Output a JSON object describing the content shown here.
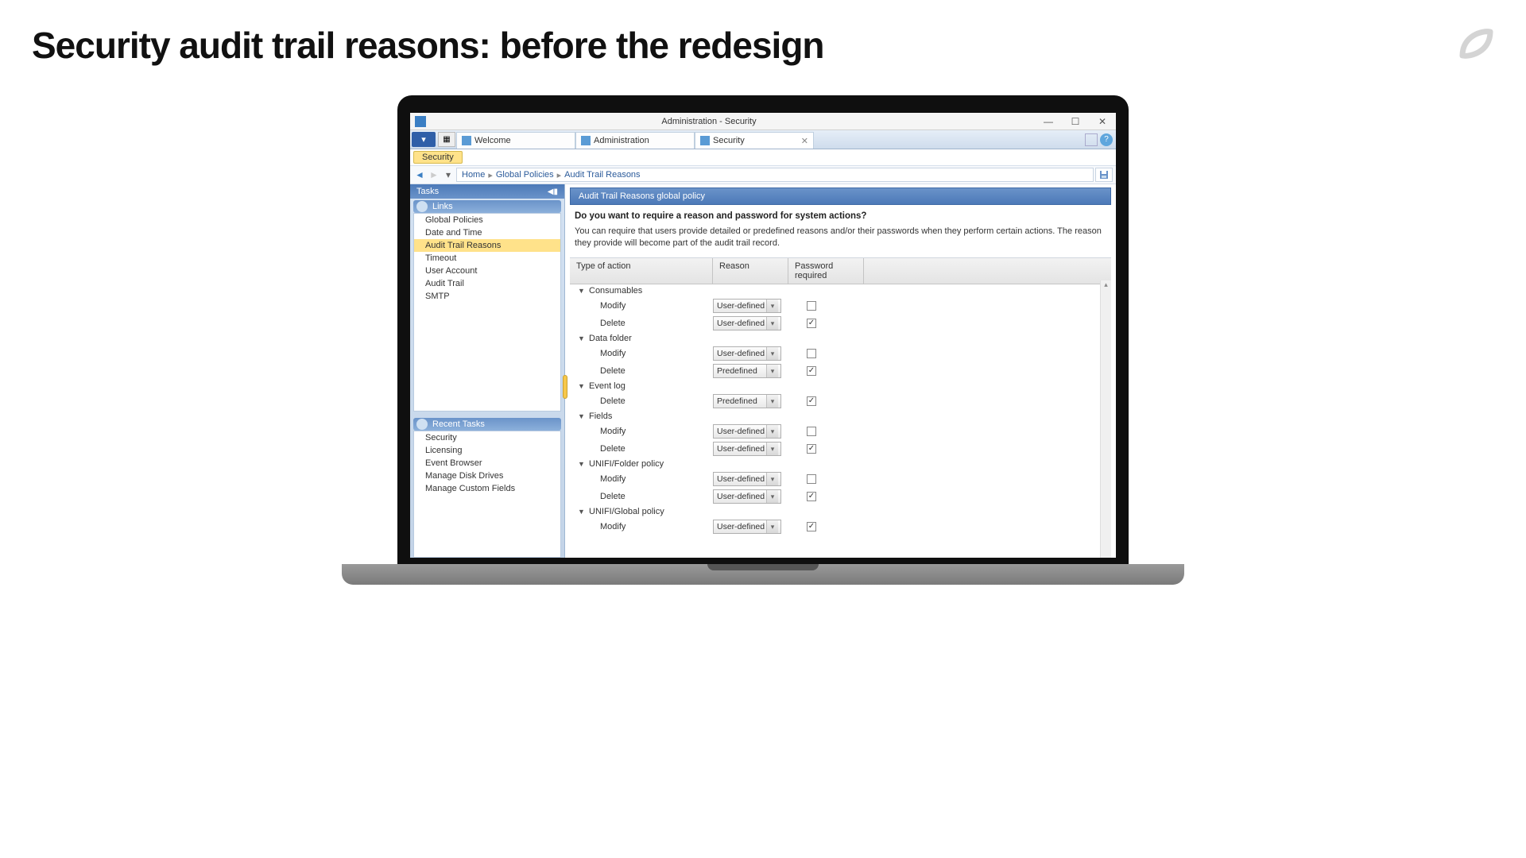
{
  "slide": {
    "title": "Security audit trail reasons: before the redesign"
  },
  "window": {
    "title": "Administration - Security"
  },
  "tabs": [
    {
      "label": "Welcome",
      "active": false,
      "closable": false
    },
    {
      "label": "Administration",
      "active": false,
      "closable": false
    },
    {
      "label": "Security",
      "active": true,
      "closable": true
    }
  ],
  "sec_pill": "Security",
  "breadcrumb": [
    "Home",
    "Global Policies",
    "Audit Trail Reasons"
  ],
  "sidebar": {
    "tasks_header": "Tasks",
    "links_header": "Links",
    "links": [
      "Global Policies",
      "Date and Time",
      "Audit Trail Reasons",
      "Timeout",
      "User Account",
      "Audit Trail",
      "SMTP"
    ],
    "selected_link_index": 2,
    "recent_header": "Recent Tasks",
    "recent": [
      "Security",
      "Licensing",
      "Event Browser",
      "Manage Disk Drives",
      "Manage Custom Fields"
    ]
  },
  "main": {
    "panel_title": "Audit Trail Reasons global policy",
    "question": "Do you want to require a reason and password for system actions?",
    "description": "You can require that users provide detailed or predefined reasons and/or their passwords when they perform certain actions. The reason they provide will become part of the audit trail record.",
    "columns": {
      "action": "Type of action",
      "reason": "Reason",
      "pwd": "Password required"
    },
    "groups": [
      {
        "name": "Consumables",
        "actions": [
          {
            "label": "Modify",
            "reason": "User-defined",
            "pwd": false
          },
          {
            "label": "Delete",
            "reason": "User-defined",
            "pwd": true
          }
        ]
      },
      {
        "name": "Data folder",
        "actions": [
          {
            "label": "Modify",
            "reason": "User-defined",
            "pwd": false
          },
          {
            "label": "Delete",
            "reason": "Predefined",
            "pwd": true
          }
        ]
      },
      {
        "name": "Event log",
        "actions": [
          {
            "label": "Delete",
            "reason": "Predefined",
            "pwd": true
          }
        ]
      },
      {
        "name": "Fields",
        "actions": [
          {
            "label": "Modify",
            "reason": "User-defined",
            "pwd": false
          },
          {
            "label": "Delete",
            "reason": "User-defined",
            "pwd": true
          }
        ]
      },
      {
        "name": "UNIFI/Folder policy",
        "actions": [
          {
            "label": "Modify",
            "reason": "User-defined",
            "pwd": false
          },
          {
            "label": "Delete",
            "reason": "User-defined",
            "pwd": true
          }
        ]
      },
      {
        "name": "UNIFI/Global policy",
        "actions": [
          {
            "label": "Modify",
            "reason": "User-defined",
            "pwd": true
          }
        ]
      }
    ]
  }
}
